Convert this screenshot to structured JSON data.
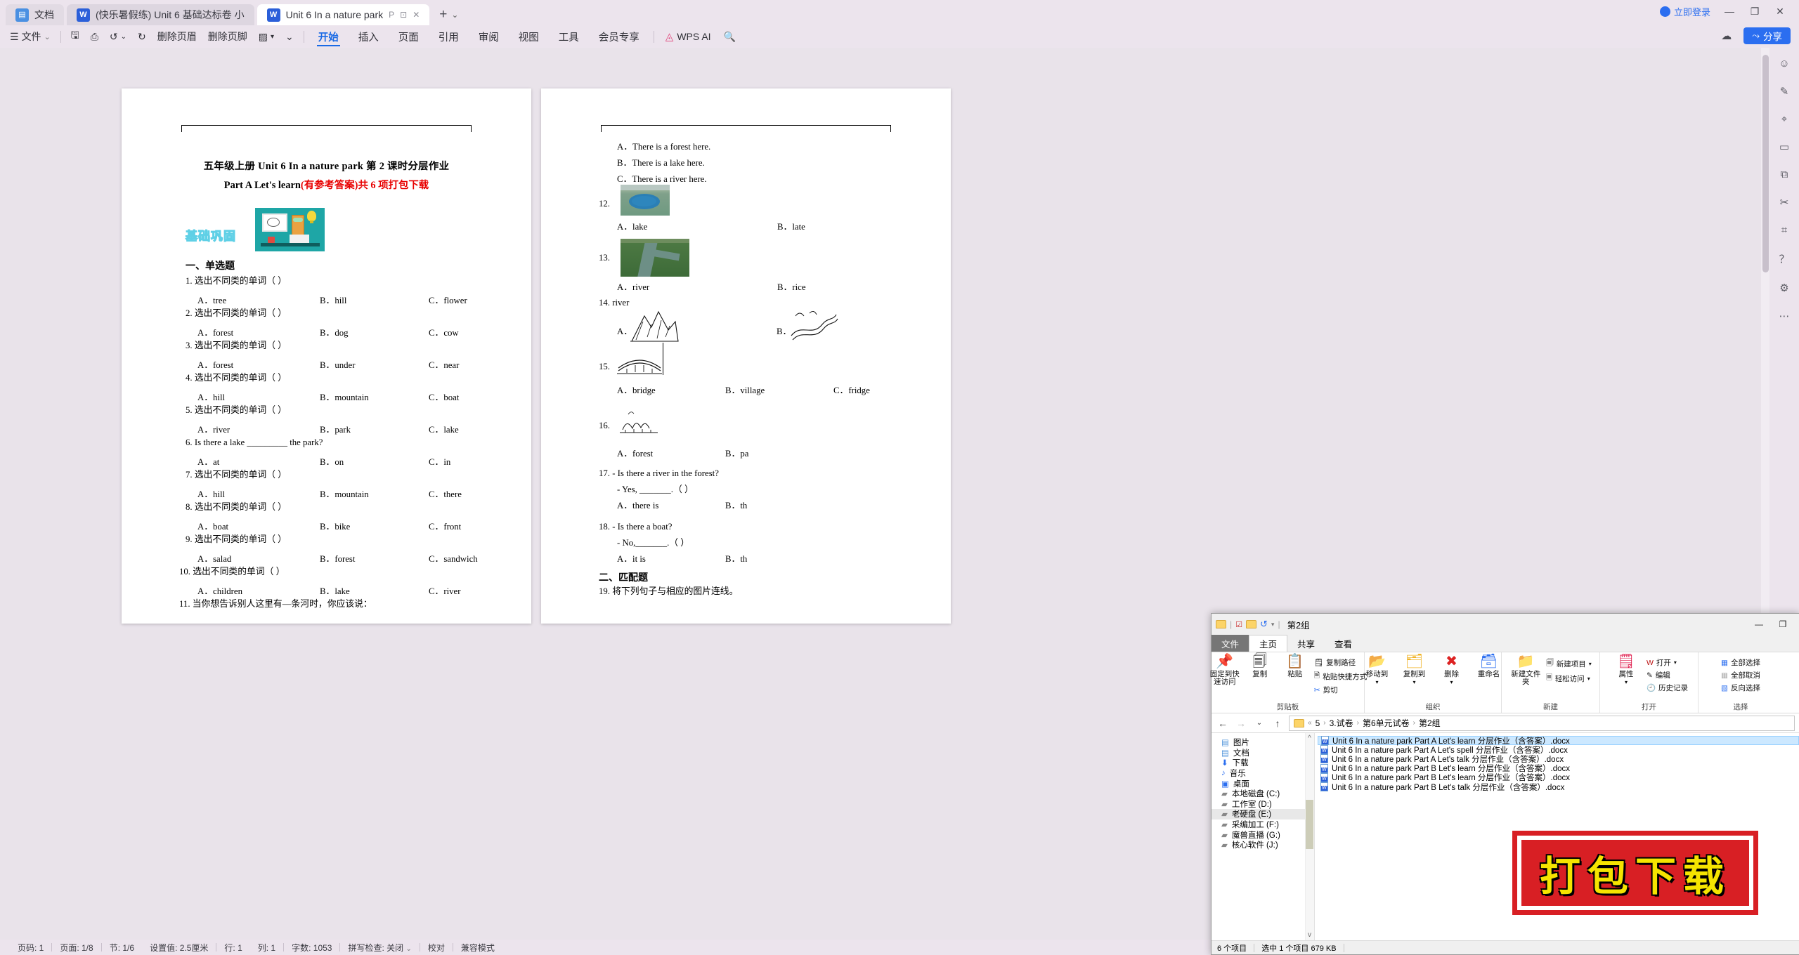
{
  "app": {
    "tabs": [
      {
        "label": "文档",
        "icon": "doc-icon",
        "type": "docs"
      },
      {
        "label": "(快乐暑假练) Unit 6 基础达标卷 小",
        "icon": "word-icon",
        "type": "inactive"
      },
      {
        "label": "Unit  6 In a nature park",
        "icon": "word-icon",
        "type": "active"
      }
    ],
    "tab_controls": [
      "P",
      "⊡",
      "✕"
    ],
    "new_tab": "+",
    "new_tab_caret": "⌄",
    "login_label": "立即登录",
    "window_controls": [
      "—",
      "❐",
      "✕"
    ],
    "share_label": "分享",
    "cloud_icon": "cloud-upload-icon"
  },
  "ribbon": {
    "file_menu": "文件",
    "quick_tools": [
      "save-icon",
      "print-preview-icon",
      "undo-icon",
      "redo-icon"
    ],
    "header_btn": "删除页眉",
    "footer_btn": "删除页脚",
    "format_painter": "format-painter-icon",
    "menus": [
      {
        "label": "开始",
        "active": true
      },
      {
        "label": "插入",
        "active": false
      },
      {
        "label": "页面",
        "active": false
      },
      {
        "label": "引用",
        "active": false
      },
      {
        "label": "审阅",
        "active": false
      },
      {
        "label": "视图",
        "active": false
      },
      {
        "label": "工具",
        "active": false
      },
      {
        "label": "会员专享",
        "active": false
      }
    ],
    "ai_label": "WPS AI",
    "search_icon": "search-icon"
  },
  "rail_icons": [
    "feedback-icon",
    "pen-icon",
    "cursor-icon",
    "comment-icon",
    "layers-icon",
    "scissors-icon",
    "ruler-icon",
    "help-icon",
    "settings-icon",
    "more-icon"
  ],
  "document": {
    "title_line1": "五年级上册   Unit   6 In a nature park 第 2 课时分层作业",
    "title_line2_black": "Part A Let's learn",
    "title_line2_red": "(有参考答案)共 6 项打包下载",
    "badge": "基础巩固",
    "section1": "一、单选题",
    "section2": "二、匹配题",
    "questions_left": [
      {
        "n": "1.",
        "text": "选出不同类的单词（    ）",
        "a": "A．tree",
        "b": "B．hill",
        "c": "C．flower"
      },
      {
        "n": "2.",
        "text": "选出不同类的单词（    ）",
        "a": "A．forest",
        "b": "B．dog",
        "c": "C．cow"
      },
      {
        "n": "3.",
        "text": "选出不同类的单词（    ）",
        "a": "A．forest",
        "b": "B．under",
        "c": "C．near"
      },
      {
        "n": "4.",
        "text": "选出不同类的单词（    ）",
        "a": "A．hill",
        "b": "B．mountain",
        "c": "C．boat"
      },
      {
        "n": "5.",
        "text": "选出不同类的单词（    ）",
        "a": "A．river",
        "b": "B．park",
        "c": "C．lake"
      },
      {
        "n": "6.",
        "text": "Is there a lake _________ the park?",
        "a": "A．at",
        "b": "B．on",
        "c": "C．in"
      },
      {
        "n": "7.",
        "text": "选出不同类的单词（    ）",
        "a": "A．hill",
        "b": "B．mountain",
        "c": "C．there"
      },
      {
        "n": "8.",
        "text": "选出不同类的单词（    ）",
        "a": "A．boat",
        "b": "B．bike",
        "c": "C．front"
      },
      {
        "n": "9.",
        "text": "选出不同类的单词（    ）",
        "a": "A．salad",
        "b": "B．forest",
        "c": "C．sandwich"
      },
      {
        "n": "10.",
        "text": "选出不同类的单词（    ）",
        "a": "A．children",
        "b": "B．lake",
        "c": "C．river"
      },
      {
        "n": "11.",
        "text": "当你想告诉别人这里有—条河时，你应该说：",
        "a": "",
        "b": "",
        "c": ""
      }
    ],
    "right_page": {
      "q11_options": [
        "A．There is a forest here.",
        "B．There is a lake here.",
        "C．There is a river here."
      ],
      "q12": {
        "n": "12.",
        "image": "lake-photo",
        "a": "A．lake",
        "b": "B．late"
      },
      "q13": {
        "n": "13.",
        "image": "river-photo",
        "a": "A．river",
        "b": "B．rice"
      },
      "q14": {
        "n": "14.",
        "text": "river",
        "a": "A．",
        "b": "B．",
        "image_a": "mountains-sketch",
        "image_b": "river-sketch"
      },
      "q15": {
        "n": "15.",
        "image": "bridge-sketch",
        "a": "A．bridge",
        "b": "B．village",
        "c": "C．fridge"
      },
      "q16": {
        "n": "16.",
        "image": "forest-sketch",
        "a": "A．forest",
        "b": "B．pa"
      },
      "q17": {
        "n": "17.",
        "text": "- Is there a river in the forest?",
        "sub": "- Yes, _______.（     ）",
        "a": "A．there is",
        "b": "B．th"
      },
      "q18": {
        "n": "18.",
        "text": "- Is there a boat?",
        "sub": "- No,_______.（     ）",
        "a": "A．it is",
        "b": "B．th"
      },
      "q19": {
        "n": "19.",
        "text": "将下列句子与相应的图片连线。"
      }
    }
  },
  "status_bar": {
    "items": [
      "页码: 1",
      "页面: 1/8",
      "节: 1/6",
      "设置值: 2.5厘米",
      "行: 1",
      "列: 1",
      "字数: 1053",
      "拼写检查: 关闭",
      "校对",
      "兼容模式"
    ]
  },
  "explorer": {
    "title": "第2组",
    "qat_icons": [
      "folder-icon",
      "properties-icon",
      "new-folder-icon",
      "undo-icon",
      "customize-caret-icon"
    ],
    "window_controls": [
      "—",
      "❐"
    ],
    "tabs": [
      {
        "label": "文件",
        "type": "file"
      },
      {
        "label": "主页",
        "type": "selected"
      },
      {
        "label": "共享",
        "type": "normal"
      },
      {
        "label": "查看",
        "type": "normal"
      }
    ],
    "ribbon_groups": [
      {
        "label": "剪贴板",
        "big": [
          {
            "label": "固定到快速访问",
            "icon": "pin-icon"
          },
          {
            "label": "复制",
            "icon": "copy-icon"
          },
          {
            "label": "粘贴",
            "icon": "paste-icon"
          }
        ],
        "small": [
          {
            "label": "复制路径",
            "icon": "copy-path-icon"
          },
          {
            "label": "粘贴快捷方式",
            "icon": "paste-shortcut-icon"
          },
          {
            "label": "剪切",
            "icon": "scissors-icon"
          }
        ]
      },
      {
        "label": "组织",
        "big": [
          {
            "label": "移动到",
            "icon": "move-to-icon"
          },
          {
            "label": "复制到",
            "icon": "copy-to-icon"
          },
          {
            "label": "删除",
            "icon": "delete-icon"
          },
          {
            "label": "重命名",
            "icon": "rename-icon"
          }
        ],
        "small": []
      },
      {
        "label": "新建",
        "big": [
          {
            "label": "新建文件夹",
            "icon": "new-folder-icon"
          }
        ],
        "small": [
          {
            "label": "新建项目",
            "icon": "new-item-icon"
          },
          {
            "label": "轻松访问",
            "icon": "easy-access-icon"
          }
        ]
      },
      {
        "label": "打开",
        "big": [
          {
            "label": "属性",
            "icon": "properties-icon"
          }
        ],
        "small": [
          {
            "label": "打开",
            "icon": "wps-open-icon"
          },
          {
            "label": "编辑",
            "icon": "edit-icon"
          },
          {
            "label": "历史记录",
            "icon": "history-icon"
          }
        ]
      },
      {
        "label": "选择",
        "big": [],
        "small": [
          {
            "label": "全部选择",
            "icon": "select-all-icon"
          },
          {
            "label": "全部取消",
            "icon": "select-none-icon"
          },
          {
            "label": "反向选择",
            "icon": "invert-selection-icon"
          }
        ]
      }
    ],
    "address": {
      "back": "←",
      "forward": "→",
      "recent": "⌄",
      "up": "↑",
      "crumbs": [
        "5",
        "3.试卷",
        "第6单元试卷",
        "第2组"
      ]
    },
    "nav_items": [
      {
        "label": "图片",
        "icon": "pictures-icon",
        "selected": false
      },
      {
        "label": "文档",
        "icon": "documents-icon",
        "selected": false
      },
      {
        "label": "下载",
        "icon": "downloads-icon",
        "selected": false
      },
      {
        "label": "音乐",
        "icon": "music-icon",
        "selected": false
      },
      {
        "label": "桌面",
        "icon": "desktop-icon",
        "selected": false
      },
      {
        "label": "本地磁盘 (C:)",
        "icon": "drive-icon",
        "selected": false
      },
      {
        "label": "工作室 (D:)",
        "icon": "drive-icon",
        "selected": false
      },
      {
        "label": "老硬盘 (E:)",
        "icon": "drive-icon",
        "selected": true
      },
      {
        "label": "采编加工 (F:)",
        "icon": "drive-icon",
        "selected": false
      },
      {
        "label": "魔兽直播 (G:)",
        "icon": "drive-icon",
        "selected": false
      },
      {
        "label": "核心软件 (J:)",
        "icon": "drive-icon",
        "selected": false
      }
    ],
    "files": [
      {
        "name": "Unit  6 In a nature park    Part A Let's learn 分层作业（含答案）.docx",
        "selected": true
      },
      {
        "name": "Unit  6 In a nature park  Part A Let's spell 分层作业（含答案）.docx",
        "selected": false
      },
      {
        "name": "Unit  6 In a nature park  Part A Let's talk 分层作业（含答案）.docx",
        "selected": false
      },
      {
        "name": "Unit  6 In a nature park  Part B Let's learn 分层作业（含答案）.docx",
        "selected": false
      },
      {
        "name": "Unit  6 In a nature park  Part B Let's learn 分层作业（含答案）.docx",
        "selected": false
      },
      {
        "name": "Unit  6 In a nature park  Part B Let's talk 分层作业（含答案）.docx",
        "selected": false
      }
    ],
    "status": [
      "6 个项目",
      "选中 1 个项目  679 KB"
    ]
  },
  "stamp": {
    "text": "打包下载",
    "bg": "#d81f24",
    "fg": "#f5e400"
  }
}
